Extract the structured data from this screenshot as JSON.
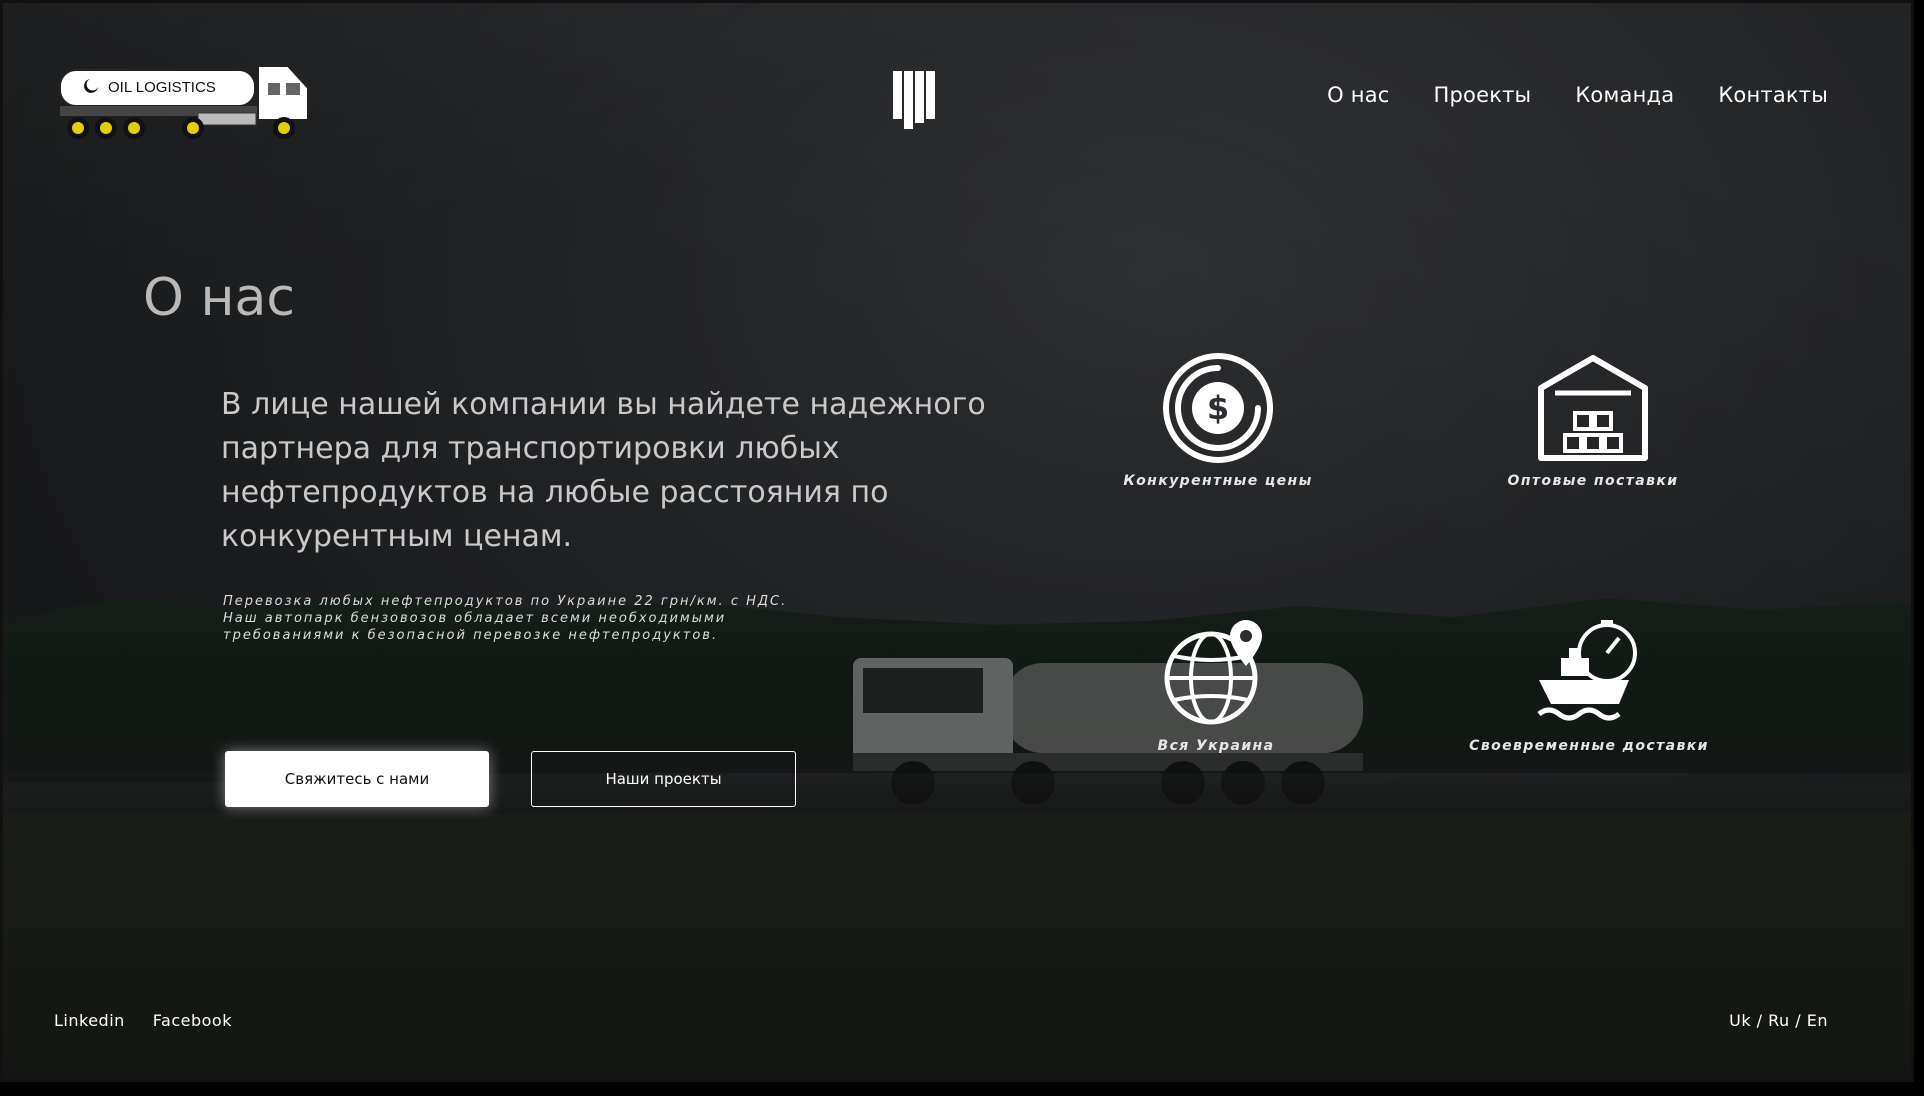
{
  "header": {
    "logo_text": "OIL LOGISTICS",
    "nav": [
      {
        "label": "О нас"
      },
      {
        "label": "Проекты"
      },
      {
        "label": "Команда"
      },
      {
        "label": "Контакты"
      }
    ]
  },
  "about": {
    "title": "О нас",
    "lead": "В лице нашей компании вы найдете надежного партнера для транспортировки любых нефтепродуктов  на любые расстояния по конкурентным ценам.",
    "details": "Перевозка  любых нефтепродуктов по Украине 22 грн/км. с НДС.\nНаш автопарк бензовозов обладает всеми необходимыми\nтребованиями к безопасной перевозке нефтепродуктов.",
    "primary_button": "Свяжитесь с нами",
    "secondary_button": "Наши проекты"
  },
  "features": [
    {
      "label": "Конкурентные цены",
      "icon": "dollar-circle-icon"
    },
    {
      "label": "Оптовые поставки",
      "icon": "warehouse-icon"
    },
    {
      "label": "Вся Украина",
      "icon": "globe-pin-icon"
    },
    {
      "label": "Своевременные доставки",
      "icon": "ship-stopwatch-icon"
    }
  ],
  "footer": {
    "social": [
      {
        "label": "Linkedin"
      },
      {
        "label": "Facebook"
      }
    ],
    "languages": "Uk / Ru / En"
  },
  "colors": {
    "background": "#2b2d30",
    "text": "#ffffff",
    "muted_text": "#b9b9b9",
    "logo_accent": "#f5d000"
  }
}
